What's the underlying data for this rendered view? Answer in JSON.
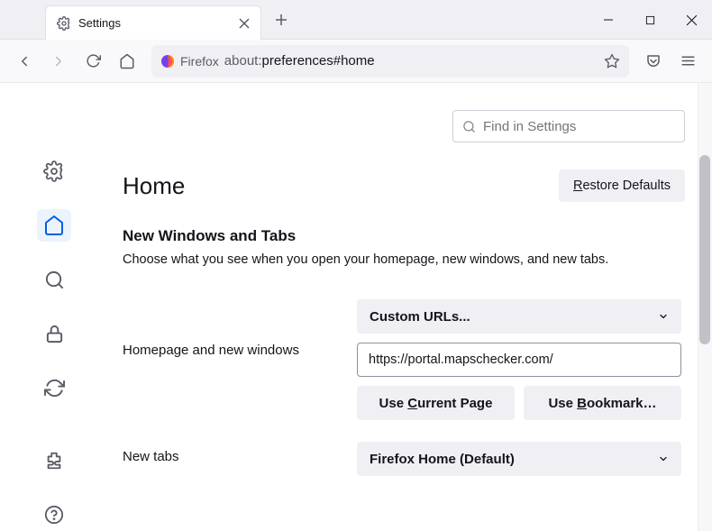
{
  "titlebar": {
    "tab_title": "Settings"
  },
  "toolbar": {
    "identity_label": "Firefox",
    "url_prefix": "about:",
    "url_path": "preferences#home"
  },
  "search": {
    "placeholder": "Find in Settings"
  },
  "page": {
    "title": "Home",
    "restore_label": "Restore Defaults",
    "restore_accel": "R"
  },
  "section": {
    "title": "New Windows and Tabs",
    "description": "Choose what you see when you open your homepage, new windows, and new tabs."
  },
  "homepage": {
    "label": "Homepage and new windows",
    "dropdown_value": "Custom URLs...",
    "url_value": "https://portal.mapschecker.com/",
    "use_current": "Use Current Page",
    "use_current_accel": "C",
    "use_bookmark": "Use Bookmark…",
    "use_bookmark_accel": "B"
  },
  "newtabs": {
    "label": "New tabs",
    "dropdown_value": "Firefox Home (Default)"
  }
}
